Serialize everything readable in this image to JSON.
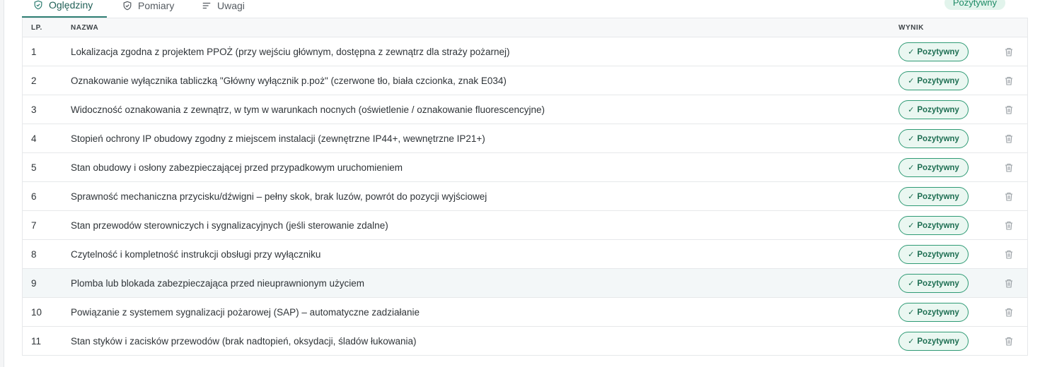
{
  "tabs": [
    {
      "label": "Oględziny",
      "icon": "shield-check-icon"
    },
    {
      "label": "Pomiary",
      "icon": "shield-icon"
    },
    {
      "label": "Uwagi",
      "icon": "list-icon"
    }
  ],
  "overall_result": "Pozytywny",
  "table": {
    "headers": {
      "lp": "LP.",
      "name": "NAZWA",
      "result": "WYNIK"
    },
    "rows": [
      {
        "lp": "1",
        "name": "Lokalizacja zgodna z projektem PPOŻ (przy wejściu głównym, dostępna z zewnątrz dla straży pożarnej)",
        "result": "Pozytywny"
      },
      {
        "lp": "2",
        "name": "Oznakowanie wyłącznika tabliczką \"Główny wyłącznik p.poż\" (czerwone tło, biała czcionka, znak E034)",
        "result": "Pozytywny"
      },
      {
        "lp": "3",
        "name": "Widoczność oznakowania z zewnątrz, w tym w warunkach nocnych (oświetlenie / oznakowanie fluorescencyjne)",
        "result": "Pozytywny"
      },
      {
        "lp": "4",
        "name": "Stopień ochrony IP obudowy zgodny z miejscem instalacji (zewnętrzne IP44+, wewnętrzne IP21+)",
        "result": "Pozytywny"
      },
      {
        "lp": "5",
        "name": "Stan obudowy i osłony zabezpieczającej przed przypadkowym uruchomieniem",
        "result": "Pozytywny"
      },
      {
        "lp": "6",
        "name": "Sprawność mechaniczna przycisku/dźwigni – pełny skok, brak luzów, powrót do pozycji wyjściowej",
        "result": "Pozytywny"
      },
      {
        "lp": "7",
        "name": "Stan przewodów sterowniczych i sygnalizacyjnych (jeśli sterowanie zdalne)",
        "result": "Pozytywny"
      },
      {
        "lp": "8",
        "name": "Czytelność i kompletność instrukcji obsługi przy wyłączniku",
        "result": "Pozytywny"
      },
      {
        "lp": "9",
        "name": "Plomba lub blokada zabezpieczająca przed nieuprawnionym użyciem",
        "result": "Pozytywny"
      },
      {
        "lp": "10",
        "name": "Powiązanie z systemem sygnalizacji pożarowej (SAP) – automatyczne zadziałanie",
        "result": "Pozytywny"
      },
      {
        "lp": "11",
        "name": "Stan styków i zacisków przewodów (brak nadtopień, oksydacji, śladów łukowania)",
        "result": "Pozytywny"
      }
    ]
  },
  "colors": {
    "accent": "#2f7f73",
    "positive": "#2e9a74",
    "positive_bg": "#eaf7f1"
  }
}
